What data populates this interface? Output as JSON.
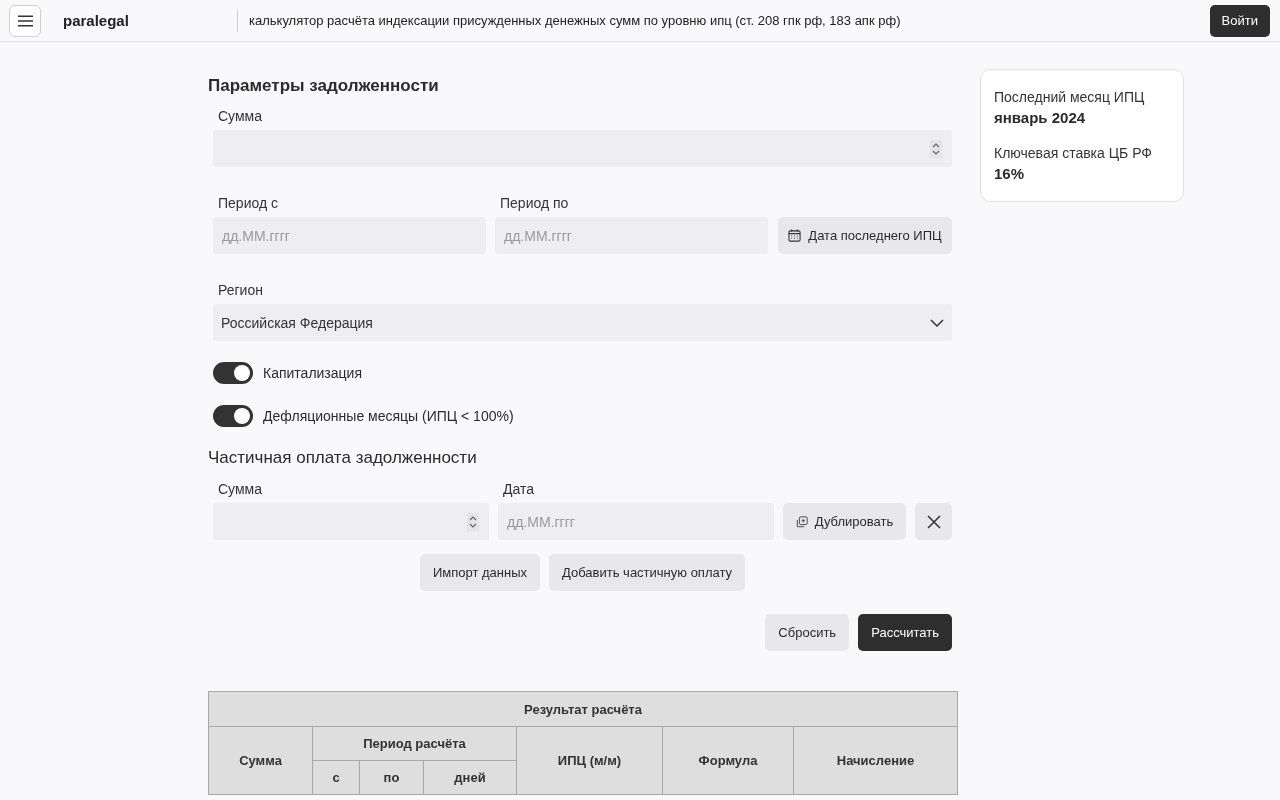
{
  "header": {
    "brand": "paralegal",
    "subtitle": "калькулятор расчёта индексации присужденных денежных сумм по уровню ипц (ст. 208 гпк рф, 183 апк рф)",
    "login_button": "Войти"
  },
  "debt": {
    "title": "Параметры задолженности",
    "amount": {
      "label": "Сумма"
    },
    "period_from": {
      "label": "Период с",
      "placeholder": "дд.ММ.гггг"
    },
    "period_to": {
      "label": "Период по",
      "placeholder": "дд.ММ.гггг"
    },
    "last_cpi_button": "Дата последнего ИПЦ",
    "region": {
      "label": "Регион",
      "value": "Российская Федерация"
    },
    "toggles": [
      {
        "label": "Капитализация",
        "on": true
      },
      {
        "label": "Дефляционные месяцы (ИПЦ < 100%)",
        "on": true
      }
    ]
  },
  "partial_payment": {
    "title": "Частичная оплата задолженности",
    "rows": [
      {
        "amount_label": "Сумма",
        "date_label": "Дата",
        "date_placeholder": "дд.ММ.гггг",
        "duplicate_button": "Дублировать"
      }
    ],
    "import_button": "Импорт данных",
    "add_button": "Добавить частичную оплату"
  },
  "actions": {
    "reset_button": "Сбросить",
    "calculate_button": "Рассчитать"
  },
  "info_card": {
    "items": [
      {
        "label": "Последний месяц ИПЦ",
        "value": "январь 2024"
      },
      {
        "label": "Ключевая ставка ЦБ РФ",
        "value": "16%"
      }
    ]
  },
  "result_table": {
    "title": "Результат расчёта",
    "columns": [
      {
        "label": "Сумма"
      },
      {
        "label": "Период расчёта",
        "children": [
          {
            "label": "с"
          },
          {
            "label": "по"
          },
          {
            "label": "дней"
          }
        ]
      },
      {
        "label": "ИПЦ (м/м)"
      },
      {
        "label": "Формула"
      },
      {
        "label": "Начисление"
      }
    ]
  }
}
